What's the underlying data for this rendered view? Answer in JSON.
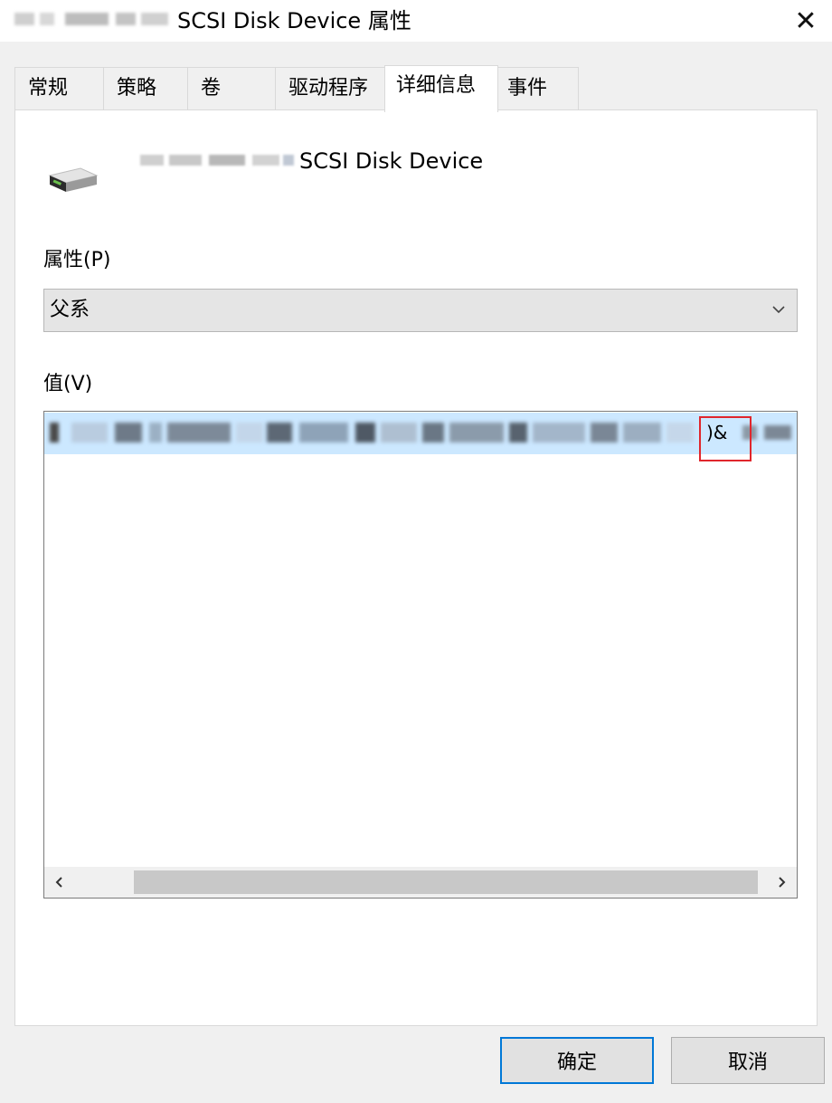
{
  "window": {
    "title": "SCSI Disk Device 属性",
    "close_glyph": "✕"
  },
  "tabs": [
    {
      "label": "常规"
    },
    {
      "label": "策略"
    },
    {
      "label": "卷"
    },
    {
      "label": "驱动程序"
    },
    {
      "label": "详细信息",
      "active": true
    },
    {
      "label": "事件"
    }
  ],
  "device": {
    "name": "SCSI Disk Device",
    "icon": "drive-icon"
  },
  "property": {
    "label": "属性(P)",
    "selected": "父系"
  },
  "value": {
    "label": "值(V)",
    "visible_fragment": ")&"
  },
  "buttons": {
    "ok": "确定",
    "cancel": "取消"
  },
  "colors": {
    "selection": "#cce8ff",
    "highlight_box": "#e0262c",
    "default_button_border": "#0078d7"
  }
}
